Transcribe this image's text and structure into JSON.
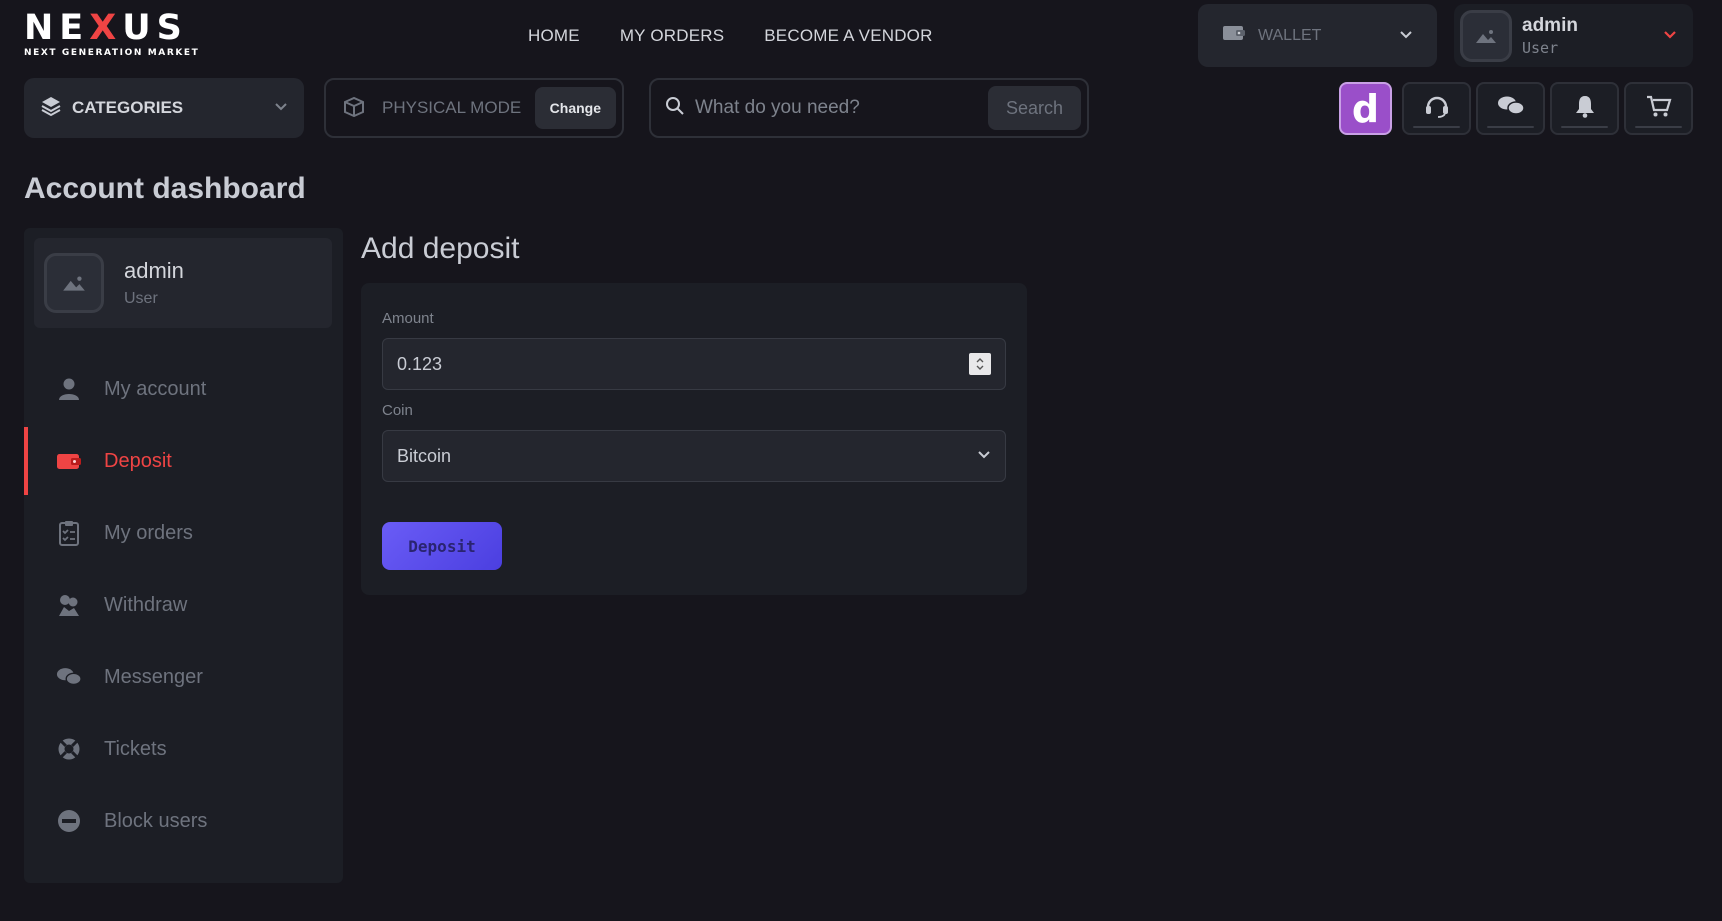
{
  "logo": {
    "main_pre": "NE",
    "main_x": "X",
    "main_post": "US",
    "sub": "NEXT GENERATION MARKET"
  },
  "topnav": {
    "home": "HOME",
    "orders": "MY ORDERS",
    "vendor": "BECOME A VENDOR"
  },
  "wallet": {
    "label": "WALLET"
  },
  "user": {
    "name": "admin",
    "role": "User"
  },
  "categories": {
    "label": "CATEGORIES"
  },
  "mode": {
    "label": "PHYSICAL MODE",
    "change": "Change"
  },
  "search": {
    "placeholder": "What do you need?",
    "button": "Search"
  },
  "header_buttons": {
    "d_label": "d"
  },
  "page": {
    "title": "Account dashboard"
  },
  "sidebar": {
    "profile": {
      "name": "admin",
      "role": "User"
    },
    "items": [
      {
        "label": "My account",
        "icon": "user-icon"
      },
      {
        "label": "Deposit",
        "icon": "wallet-icon",
        "active": true
      },
      {
        "label": "My orders",
        "icon": "clipboard-icon"
      },
      {
        "label": "Withdraw",
        "icon": "money-icon"
      },
      {
        "label": "Messenger",
        "icon": "chat-icon"
      },
      {
        "label": "Tickets",
        "icon": "lifebuoy-icon"
      },
      {
        "label": "Block users",
        "icon": "block-icon"
      }
    ]
  },
  "deposit": {
    "title": "Add deposit",
    "amount_label": "Amount",
    "amount_value": "0.123",
    "coin_label": "Coin",
    "coin_value": "Bitcoin",
    "button": "Deposit"
  },
  "colors": {
    "accent_red": "#ef4444",
    "accent_purple": "#9a4fc9",
    "button_indigo": "#5b4ff0"
  }
}
